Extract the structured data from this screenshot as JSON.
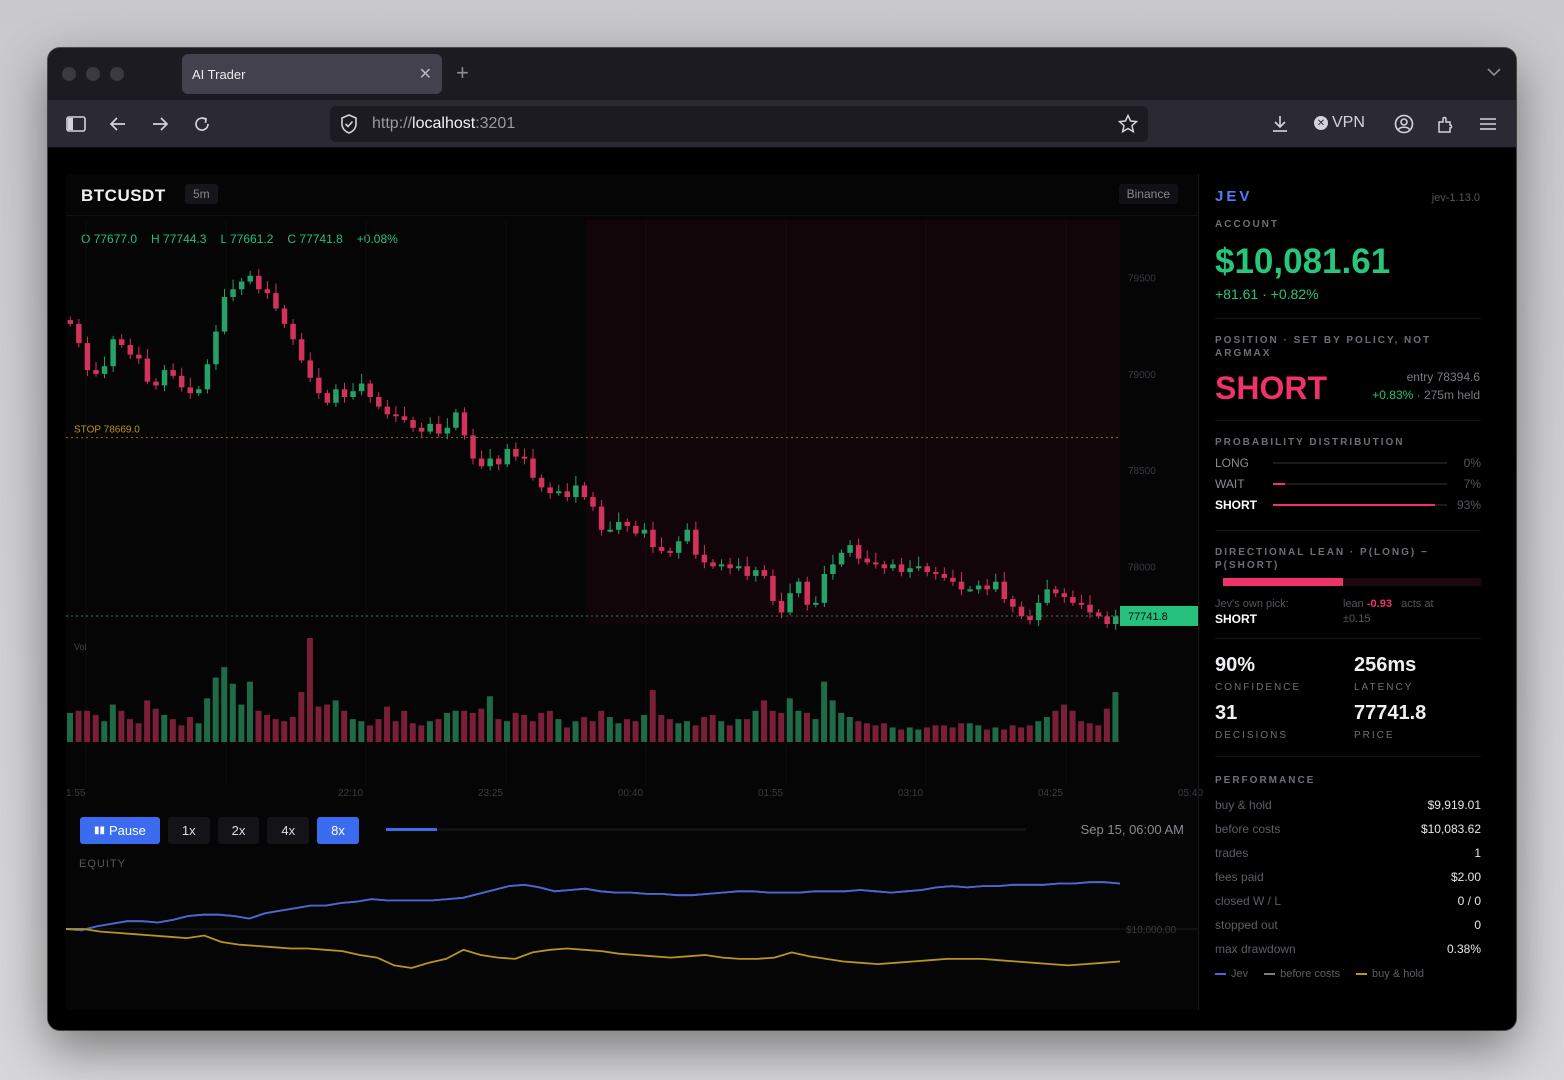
{
  "browser": {
    "tab_title": "AI Trader",
    "url_prefix": "http://",
    "url_host": "localhost",
    "url_port": ":3201",
    "vpn_label": "VPN",
    "icons": [
      "sidebar-icon",
      "back-icon",
      "forward-icon",
      "reload-icon",
      "shield-icon",
      "star-icon",
      "download-icon",
      "vpn-icon",
      "account-icon",
      "extensions-icon",
      "menu-icon"
    ]
  },
  "chart": {
    "symbol": "BTCUSDT",
    "interval": "5m",
    "exchange": "Binance",
    "ohlc": {
      "o": "O 77677.0",
      "h": "H 77744.3",
      "l": "L 77661.2",
      "c": "C 77741.8",
      "chg": "+0.08%"
    },
    "stop_label": "STOP 78669.0",
    "price_tag": "77741.8",
    "vol_label": "Vol",
    "equity_label": "EQUITY",
    "equity_baseline_label": "$10,000.00",
    "clock": "Sep 15, 06:00 AM",
    "controls": {
      "pause": "Pause",
      "speeds": [
        "1x",
        "2x",
        "4x",
        "8x"
      ],
      "active_speed": "8x"
    },
    "replay_progress": 0.08,
    "colors": {
      "up": "#26a269",
      "down": "#d2335c",
      "jev": "#4a66d8",
      "bnh": "#b8951e",
      "accent": "#3b6cf0"
    }
  },
  "chart_data": {
    "type": "candlestick",
    "price_ticks": [
      "79500",
      "79000",
      "78500",
      "78000"
    ],
    "price_tick_values": [
      79500,
      79000,
      78500,
      78000
    ],
    "ylim": [
      77700,
      79800
    ],
    "stop_price": 78669.0,
    "last_price": 77741.8,
    "time_ticks": [
      "1:55",
      "22:10",
      "23:25",
      "00:40",
      "01:55",
      "03:10",
      "04:25",
      "05:40"
    ],
    "closes": [
      79260,
      79160,
      79020,
      79000,
      79040,
      79180,
      79150,
      79100,
      79080,
      78960,
      78940,
      79020,
      78990,
      78930,
      78900,
      78920,
      79050,
      79220,
      79400,
      79440,
      79480,
      79510,
      79440,
      79420,
      79340,
      79260,
      79180,
      79070,
      78980,
      78900,
      78850,
      78920,
      78880,
      78910,
      78950,
      78880,
      78830,
      78790,
      78780,
      78760,
      78720,
      78700,
      78740,
      78690,
      78720,
      78800,
      78680,
      78560,
      78520,
      78560,
      78530,
      78610,
      78570,
      78560,
      78460,
      78410,
      78380,
      78390,
      78360,
      78420,
      78360,
      78310,
      78190,
      78190,
      78230,
      78210,
      78170,
      78190,
      78100,
      78080,
      78070,
      78130,
      78190,
      78060,
      78020,
      78000,
      78010,
      77990,
      78000,
      77950,
      77980,
      77950,
      77820,
      77760,
      77860,
      77920,
      77800,
      77810,
      77960,
      78010,
      78070,
      78110,
      78040,
      78020,
      78010,
      77990,
      78010,
      77970,
      77990,
      78000,
      77970,
      77960,
      77940,
      77920,
      77880,
      77880,
      77900,
      77880,
      77920,
      77830,
      77790,
      77740,
      77720,
      77810,
      77880,
      77860,
      77840,
      77810,
      77800,
      77760,
      77740,
      77700,
      77740
    ],
    "volumes": [
      0.28,
      0.3,
      0.3,
      0.26,
      0.2,
      0.36,
      0.3,
      0.22,
      0.18,
      0.4,
      0.32,
      0.26,
      0.22,
      0.16,
      0.24,
      0.18,
      0.42,
      0.62,
      0.72,
      0.56,
      0.36,
      0.58,
      0.3,
      0.26,
      0.22,
      0.2,
      0.24,
      0.48,
      1.0,
      0.34,
      0.36,
      0.4,
      0.3,
      0.22,
      0.2,
      0.16,
      0.22,
      0.34,
      0.2,
      0.3,
      0.18,
      0.16,
      0.2,
      0.22,
      0.28,
      0.3,
      0.3,
      0.28,
      0.32,
      0.44,
      0.22,
      0.2,
      0.28,
      0.26,
      0.2,
      0.28,
      0.3,
      0.22,
      0.14,
      0.2,
      0.24,
      0.2,
      0.3,
      0.24,
      0.18,
      0.22,
      0.2,
      0.26,
      0.5,
      0.26,
      0.22,
      0.18,
      0.2,
      0.16,
      0.24,
      0.26,
      0.2,
      0.16,
      0.22,
      0.22,
      0.3,
      0.4,
      0.3,
      0.28,
      0.42,
      0.3,
      0.28,
      0.22,
      0.58,
      0.4,
      0.28,
      0.24,
      0.2,
      0.18,
      0.16,
      0.18,
      0.14,
      0.12,
      0.14,
      0.12,
      0.14,
      0.16,
      0.16,
      0.14,
      0.18,
      0.18,
      0.16,
      0.12,
      0.14,
      0.12,
      0.16,
      0.14,
      0.16,
      0.2,
      0.24,
      0.3,
      0.36,
      0.3,
      0.2,
      0.18,
      0.16,
      0.32,
      0.48
    ],
    "equity": {
      "jev": [
        0.5,
        0.49,
        0.52,
        0.54,
        0.56,
        0.56,
        0.55,
        0.57,
        0.6,
        0.61,
        0.61,
        0.6,
        0.58,
        0.62,
        0.64,
        0.66,
        0.68,
        0.68,
        0.7,
        0.71,
        0.73,
        0.72,
        0.72,
        0.72,
        0.72,
        0.73,
        0.74,
        0.77,
        0.8,
        0.83,
        0.84,
        0.82,
        0.79,
        0.8,
        0.81,
        0.79,
        0.78,
        0.78,
        0.77,
        0.77,
        0.76,
        0.76,
        0.77,
        0.78,
        0.79,
        0.79,
        0.78,
        0.78,
        0.78,
        0.79,
        0.79,
        0.79,
        0.8,
        0.79,
        0.78,
        0.79,
        0.8,
        0.82,
        0.83,
        0.82,
        0.83,
        0.83,
        0.84,
        0.84,
        0.84,
        0.85,
        0.85,
        0.86,
        0.86,
        0.85
      ],
      "before_costs": [
        0.5,
        0.49,
        0.52,
        0.54,
        0.56,
        0.56,
        0.55,
        0.57,
        0.6,
        0.61,
        0.61,
        0.6,
        0.58,
        0.62,
        0.64,
        0.66,
        0.68,
        0.68,
        0.7,
        0.71,
        0.73,
        0.72,
        0.72,
        0.72,
        0.72,
        0.73,
        0.74,
        0.77,
        0.8,
        0.83,
        0.84,
        0.82,
        0.79,
        0.8,
        0.81,
        0.79,
        0.78,
        0.78,
        0.77,
        0.77,
        0.76,
        0.76,
        0.77,
        0.78,
        0.79,
        0.79,
        0.78,
        0.78,
        0.78,
        0.79,
        0.79,
        0.79,
        0.8,
        0.79,
        0.78,
        0.79,
        0.8,
        0.82,
        0.83,
        0.82,
        0.83,
        0.83,
        0.84,
        0.84,
        0.84,
        0.85,
        0.85,
        0.86,
        0.86,
        0.85
      ],
      "buy_hold": [
        0.5,
        0.5,
        0.48,
        0.47,
        0.46,
        0.45,
        0.44,
        0.43,
        0.45,
        0.4,
        0.38,
        0.37,
        0.36,
        0.35,
        0.35,
        0.34,
        0.33,
        0.3,
        0.28,
        0.22,
        0.2,
        0.24,
        0.27,
        0.34,
        0.3,
        0.28,
        0.27,
        0.32,
        0.34,
        0.35,
        0.34,
        0.33,
        0.31,
        0.3,
        0.29,
        0.28,
        0.29,
        0.3,
        0.28,
        0.27,
        0.27,
        0.28,
        0.32,
        0.29,
        0.27,
        0.25,
        0.24,
        0.23,
        0.24,
        0.25,
        0.26,
        0.27,
        0.27,
        0.27,
        0.26,
        0.25,
        0.24,
        0.23,
        0.22,
        0.23,
        0.24,
        0.25
      ]
    }
  },
  "side": {
    "brand": "JEV",
    "version": "jev-1.13.0",
    "account_label": "ACCOUNT",
    "balance": "$10,081.61",
    "pnl": "+81.61  ·  +0.82%",
    "position_label": "POSITION · SET BY POLICY, NOT ARGMAX",
    "position": "SHORT",
    "entry": "entry 78394.6",
    "entry_pct": "+0.83%",
    "entry_held": " · 275m held",
    "prob_label": "PROBABILITY DISTRIBUTION",
    "probs": [
      {
        "name": "LONG",
        "pct": "0%",
        "value": 0.0
      },
      {
        "name": "WAIT",
        "pct": "7%",
        "value": 0.07
      },
      {
        "name": "SHORT",
        "pct": "93%",
        "value": 0.93
      }
    ],
    "lean_label": "DIRECTIONAL LEAN · P(LONG) − P(SHORT)",
    "lean_value": 0.93,
    "own_pick_label": "Jev's own pick:",
    "own_pick": "SHORT",
    "lean_text": "lean",
    "lean_num": "-0.93",
    "acts_at": "acts at",
    "acts_threshold": "±0.15",
    "stats": [
      {
        "value": "90%",
        "label": "CONFIDENCE"
      },
      {
        "value": "256ms",
        "label": "LATENCY"
      },
      {
        "value": "31",
        "label": "DECISIONS"
      },
      {
        "value": "77741.8",
        "label": "PRICE"
      }
    ],
    "perf_label": "PERFORMANCE",
    "perf": [
      {
        "k": "buy & hold",
        "v": "$9,919.01"
      },
      {
        "k": "before costs",
        "v": "$10,083.62"
      },
      {
        "k": "trades",
        "v": "1"
      },
      {
        "k": "fees paid",
        "v": "$2.00"
      },
      {
        "k": "closed W / L",
        "v": "0 / 0"
      },
      {
        "k": "stopped out",
        "v": "0"
      },
      {
        "k": "max drawdown",
        "v": "0.38%"
      }
    ],
    "legend": [
      "Jev",
      "before costs",
      "buy & hold"
    ]
  }
}
